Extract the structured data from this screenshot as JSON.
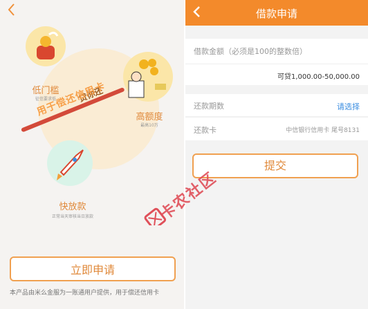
{
  "left": {
    "back_icon": "chevron-left-icon",
    "features": {
      "low_threshold": {
        "title": "低门槛",
        "desc": "征信要求低"
      },
      "high_limit": {
        "title": "高额度",
        "desc": "最高10万"
      },
      "fast_release": {
        "title": "快放款",
        "desc": "正常当天审核当日放款"
      }
    },
    "badge": "贷你还",
    "slogan": "用于偿还信用卡",
    "apply_button": "立即申请",
    "footnote": "本产品由米么金服为一账通用户提供，用于偿还信用卡"
  },
  "right": {
    "title": "借款申请",
    "back_icon": "chevron-left-icon",
    "amount_label": "借款金额（必须是100的整数倍）",
    "amount_range": "可贷1,000.00-50,000.00",
    "term_label": "还款期数",
    "term_select": "请选择",
    "card_label": "还款卡",
    "card_value": "中信银行信用卡 尾号8131",
    "submit_button": "提交"
  },
  "watermark": {
    "text": "卡农社区",
    "color": "#e0505a"
  },
  "colors": {
    "accent": "#f38a2b",
    "button_border": "#f0a050",
    "link": "#3a8de0"
  }
}
